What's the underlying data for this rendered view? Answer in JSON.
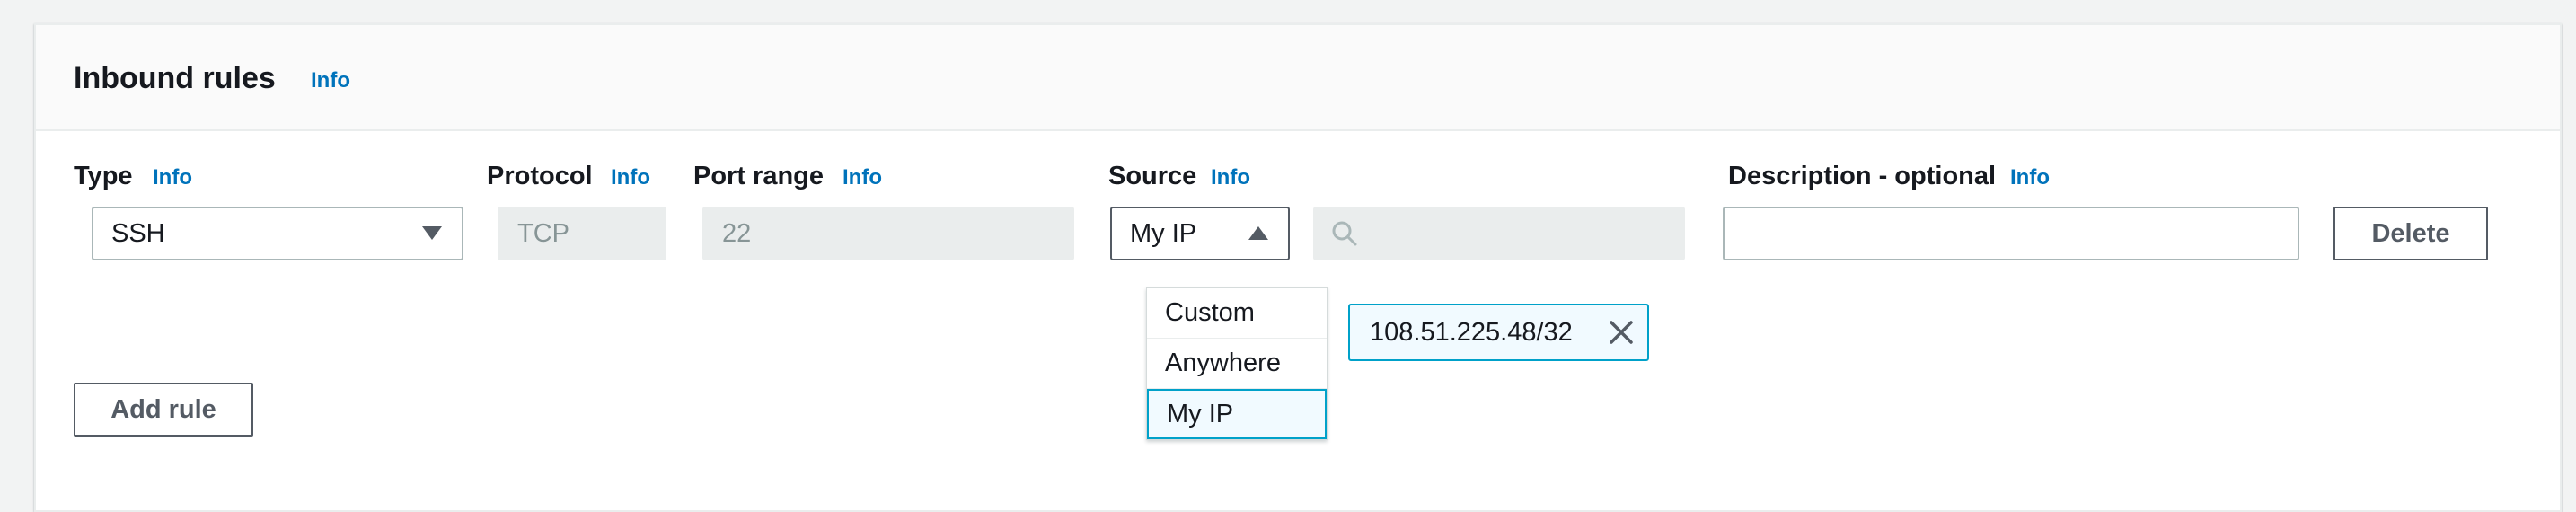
{
  "panel": {
    "title": "Inbound rules",
    "info": "Info"
  },
  "columns": {
    "type": {
      "label": "Type",
      "info": "Info"
    },
    "protocol": {
      "label": "Protocol",
      "info": "Info"
    },
    "port_range": {
      "label": "Port range",
      "info": "Info"
    },
    "source": {
      "label": "Source",
      "info": "Info"
    },
    "description": {
      "label": "Description - optional",
      "info": "Info"
    }
  },
  "rule": {
    "type_value": "SSH",
    "protocol_value": "TCP",
    "port_value": "22",
    "source_value": "My IP",
    "source_search_value": "",
    "description_value": "",
    "delete_label": "Delete"
  },
  "source_options": [
    "Custom",
    "Anywhere",
    "My IP"
  ],
  "source_token": "108.51.225.48/32",
  "add_rule_label": "Add rule",
  "colors": {
    "accent": "#0073bb",
    "selected_border": "#00a1c9",
    "selected_bg": "#f1faff"
  }
}
